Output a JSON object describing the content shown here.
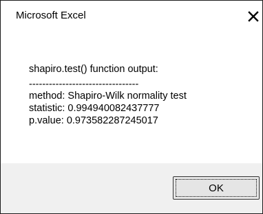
{
  "window": {
    "title": "Microsoft Excel",
    "close_icon": "close-x-icon"
  },
  "message": {
    "heading": "shapiro.test() function output:",
    "separator": "---------------------------------",
    "method": "method: Shapiro-Wilk normality test",
    "statistic": "statistic: 0.994940082437777",
    "p_value": "p.value: 0.973582287245017"
  },
  "buttons": {
    "ok_label": "OK"
  }
}
